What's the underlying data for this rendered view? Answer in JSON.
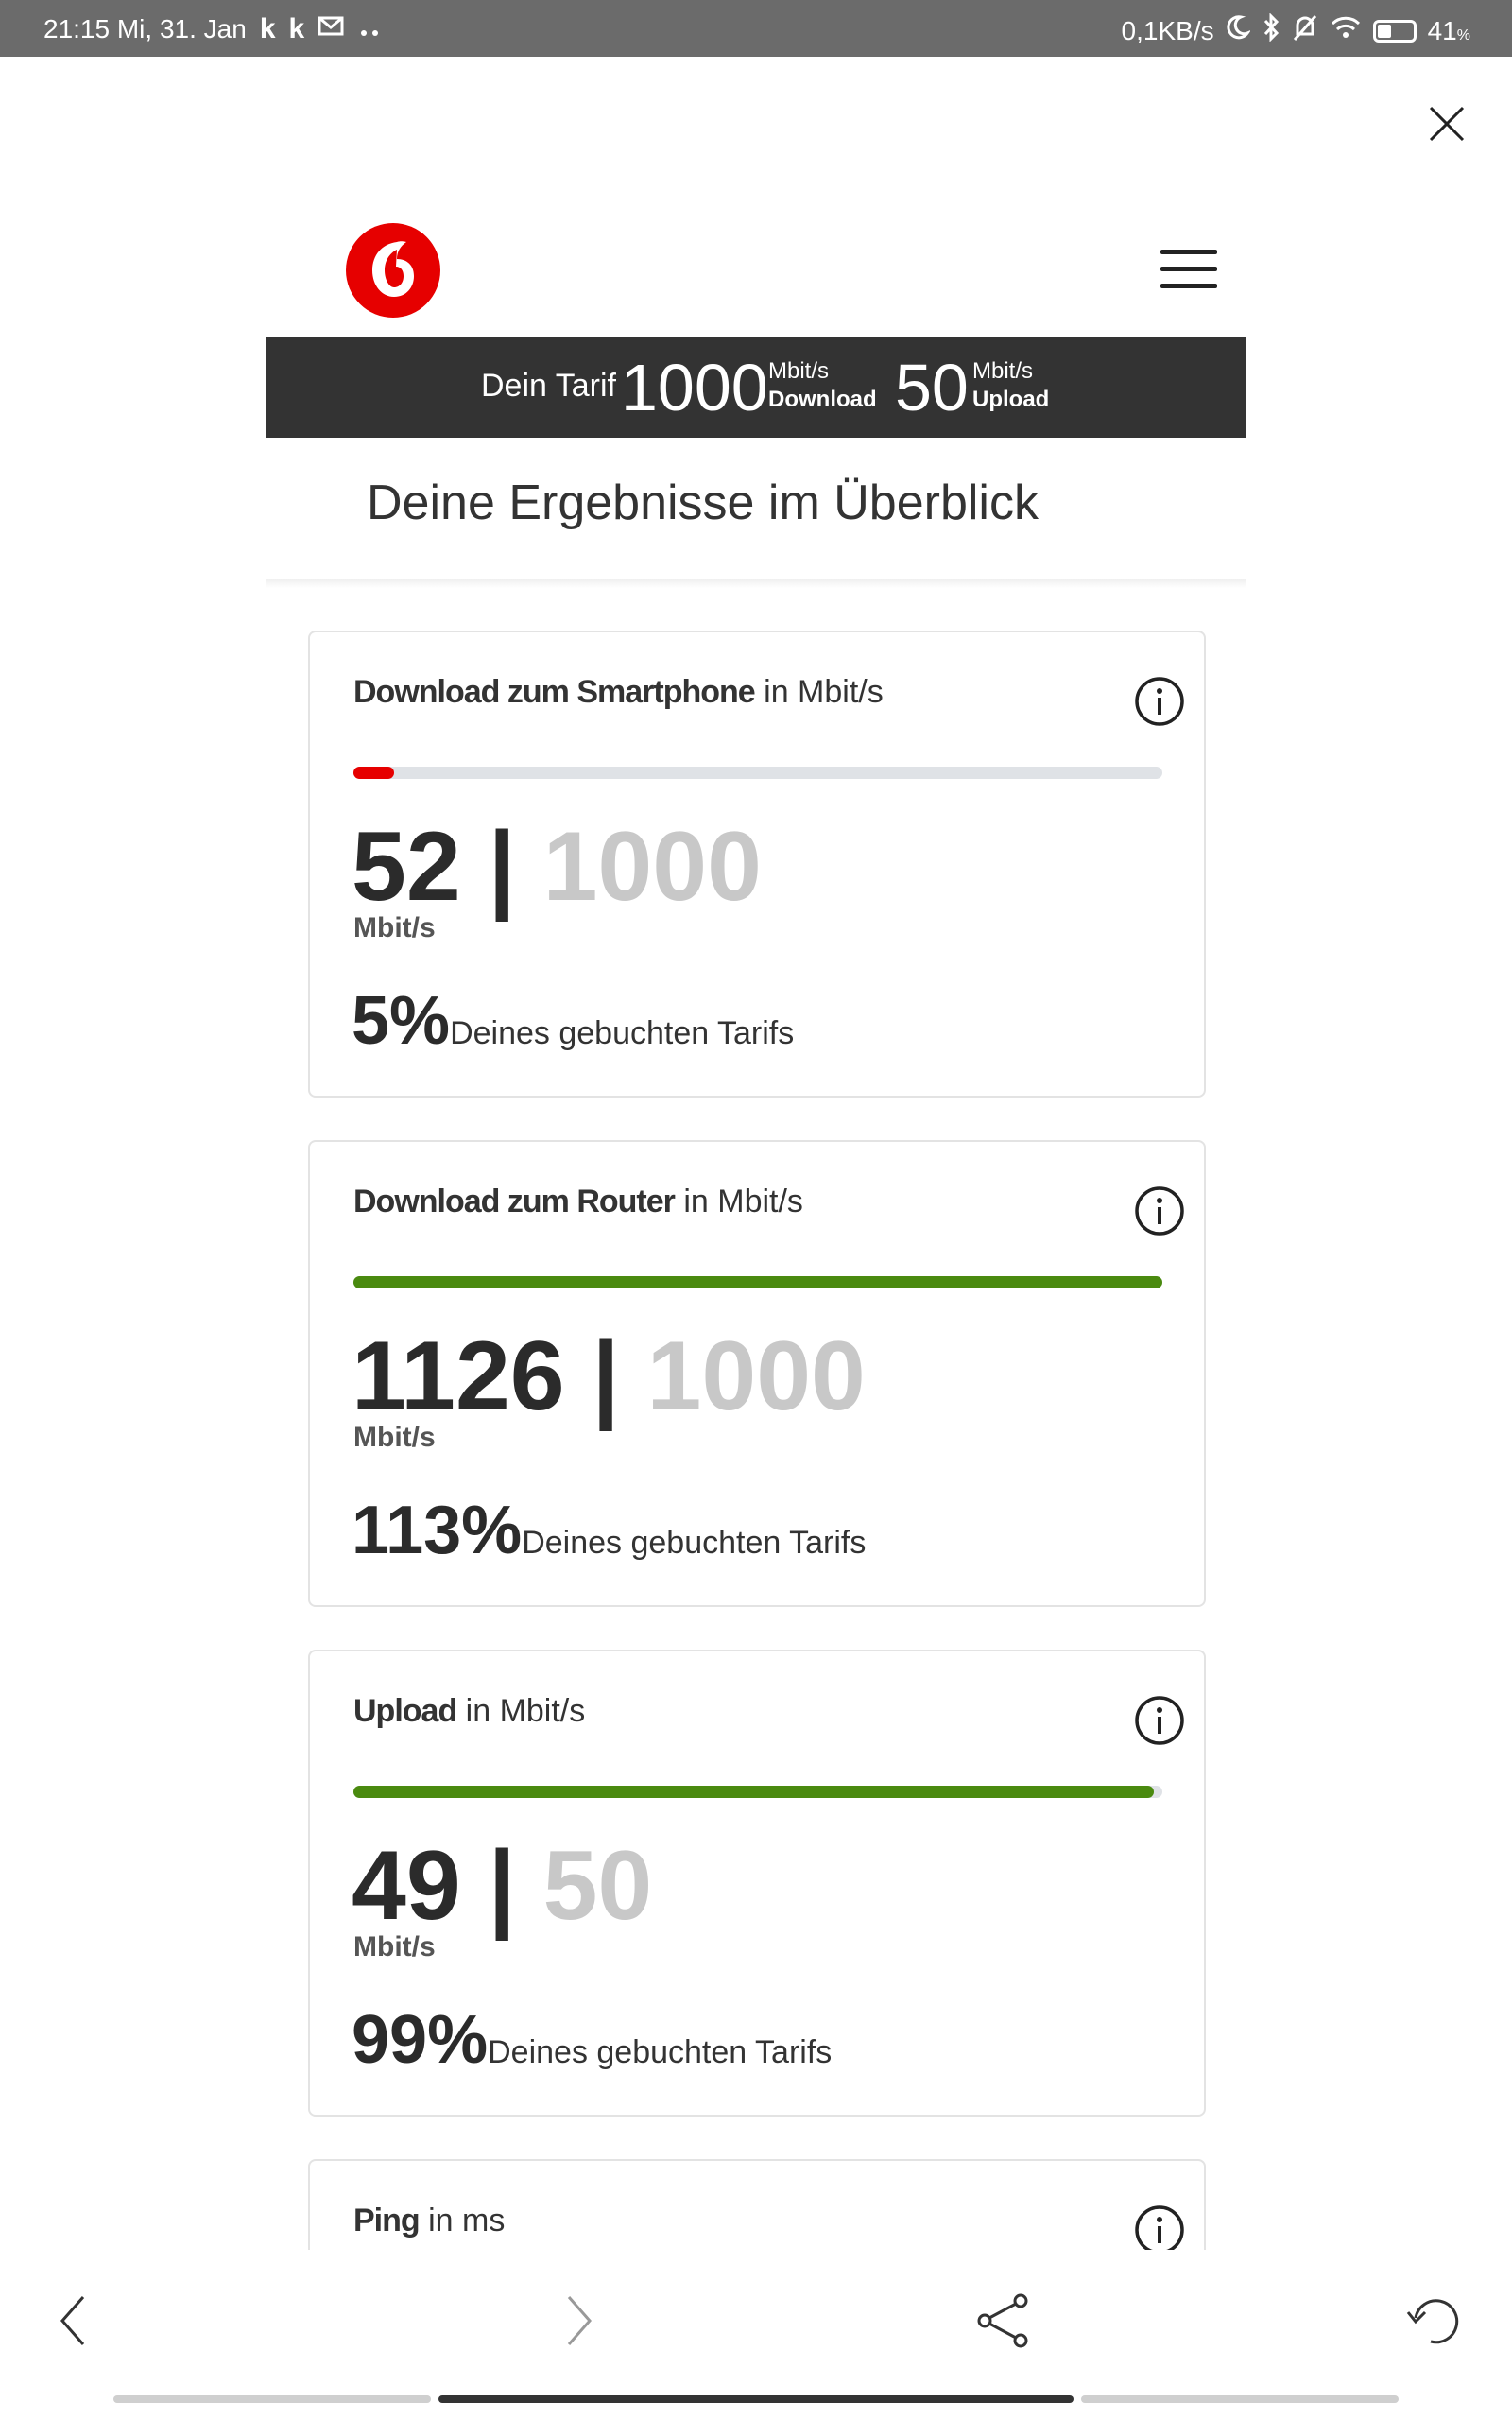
{
  "status_bar": {
    "time_date": "21:15 Mi, 31. Jan",
    "app_icon_1": "k",
    "app_icon_2": "k",
    "net_speed": "0,1KB/s",
    "battery": "41",
    "battery_unit": "%"
  },
  "header": {
    "brand_color": "#e60000"
  },
  "tariff": {
    "label": "Dein Tarif",
    "download_value": "1000",
    "download_unit": "Mbit/s",
    "download_label": "Download",
    "upload_value": "50",
    "upload_unit": "Mbit/s",
    "upload_label": "Upload"
  },
  "section_title": "Deine Ergebnisse im Überblick",
  "cards": [
    {
      "title_strong": "Download zum Smartphone",
      "title_rest": " in Mbit/s",
      "measured": "52",
      "separator": " | ",
      "booked": "1000",
      "unit": "Mbit/s",
      "percent": "5%",
      "percent_text": "Deines gebuchten Tarifs",
      "progress": 0.05,
      "bar_color": "#e60000"
    },
    {
      "title_strong": "Download zum Router",
      "title_rest": " in Mbit/s",
      "measured": "1126",
      "separator": " | ",
      "booked": "1000",
      "unit": "Mbit/s",
      "percent": "113%",
      "percent_text": "Deines gebuchten Tarifs",
      "progress": 1.0,
      "bar_color": "#4a8a0f"
    },
    {
      "title_strong": "Upload",
      "title_rest": " in Mbit/s",
      "measured": "49",
      "separator": " | ",
      "booked": "50",
      "unit": "Mbit/s",
      "percent": "99%",
      "percent_text": "Deines gebuchten Tarifs",
      "progress": 0.99,
      "bar_color": "#4a8a0f"
    },
    {
      "title_strong": "Ping",
      "title_rest": " in ms"
    }
  ],
  "icons": {
    "close": "close-icon",
    "menu": "hamburger-menu-icon",
    "info": "info-icon",
    "back": "chevron-left-icon",
    "forward": "chevron-right-icon",
    "share": "share-icon",
    "reload": "reload-icon"
  }
}
